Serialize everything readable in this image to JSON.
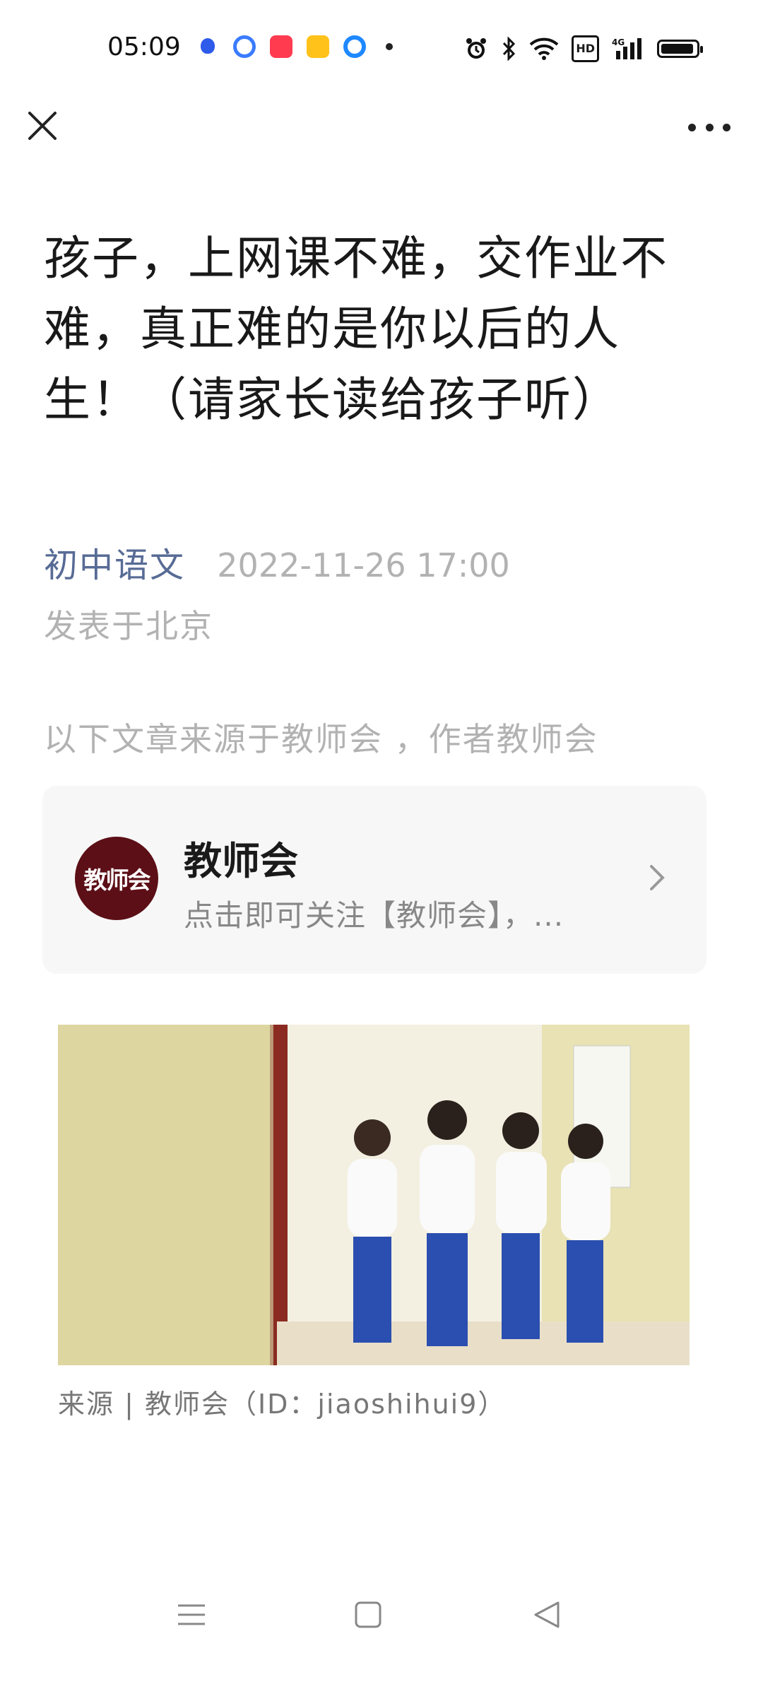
{
  "status_bar": {
    "time": "05:09",
    "notification_icons": [
      "baidu-icon",
      "q-browser-icon",
      "red-app-icon",
      "yellow-app-icon",
      "blue-circle-app-icon",
      "more-dot-icon"
    ],
    "system_icons": [
      "alarm-icon",
      "bluetooth-icon",
      "wifi-icon",
      "hd-icon",
      "signal-4g-icon",
      "battery-icon"
    ],
    "hd_label": "HD",
    "network_label": "4G"
  },
  "article": {
    "title": "孩子，上网课不难，交作业不难，真正难的是你以后的人生！（请家长读给孩子听）",
    "author": "初中语文",
    "date": "2022-11-26 17:00",
    "location": "发表于北京",
    "source_note": "以下文章来源于教师会 ，作者教师会",
    "caption": "来源 | 教师会（ID：jiaoshihui9）"
  },
  "account_card": {
    "avatar_text": "教师会",
    "name": "教师会",
    "description": "点击即可关注【教师会】，..."
  },
  "colors": {
    "link_blue": "#576b95",
    "muted_gray": "#b2b2b2",
    "avatar_bg": "#5c0f16"
  }
}
